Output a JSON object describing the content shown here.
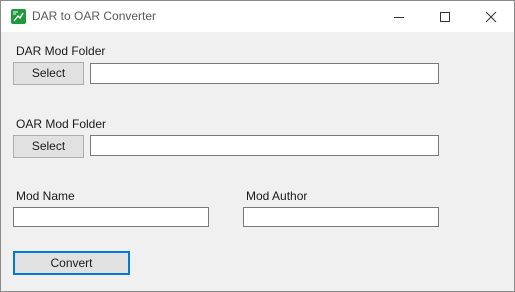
{
  "window": {
    "title": "DAR to OAR Converter"
  },
  "dar": {
    "label": "DAR Mod Folder",
    "select_label": "Select",
    "path_value": ""
  },
  "oar": {
    "label": "OAR Mod Folder",
    "select_label": "Select",
    "path_value": ""
  },
  "mod_name": {
    "label": "Mod Name",
    "value": ""
  },
  "mod_author": {
    "label": "Mod Author",
    "value": ""
  },
  "convert": {
    "label": "Convert"
  },
  "colors": {
    "app_icon": "#1e9a3a",
    "focus_border": "#0078d7",
    "window_bg": "#f0f0f0"
  },
  "icons": {
    "app": "app-icon",
    "minimize": "minimize-icon",
    "maximize": "maximize-icon",
    "close": "close-icon"
  }
}
